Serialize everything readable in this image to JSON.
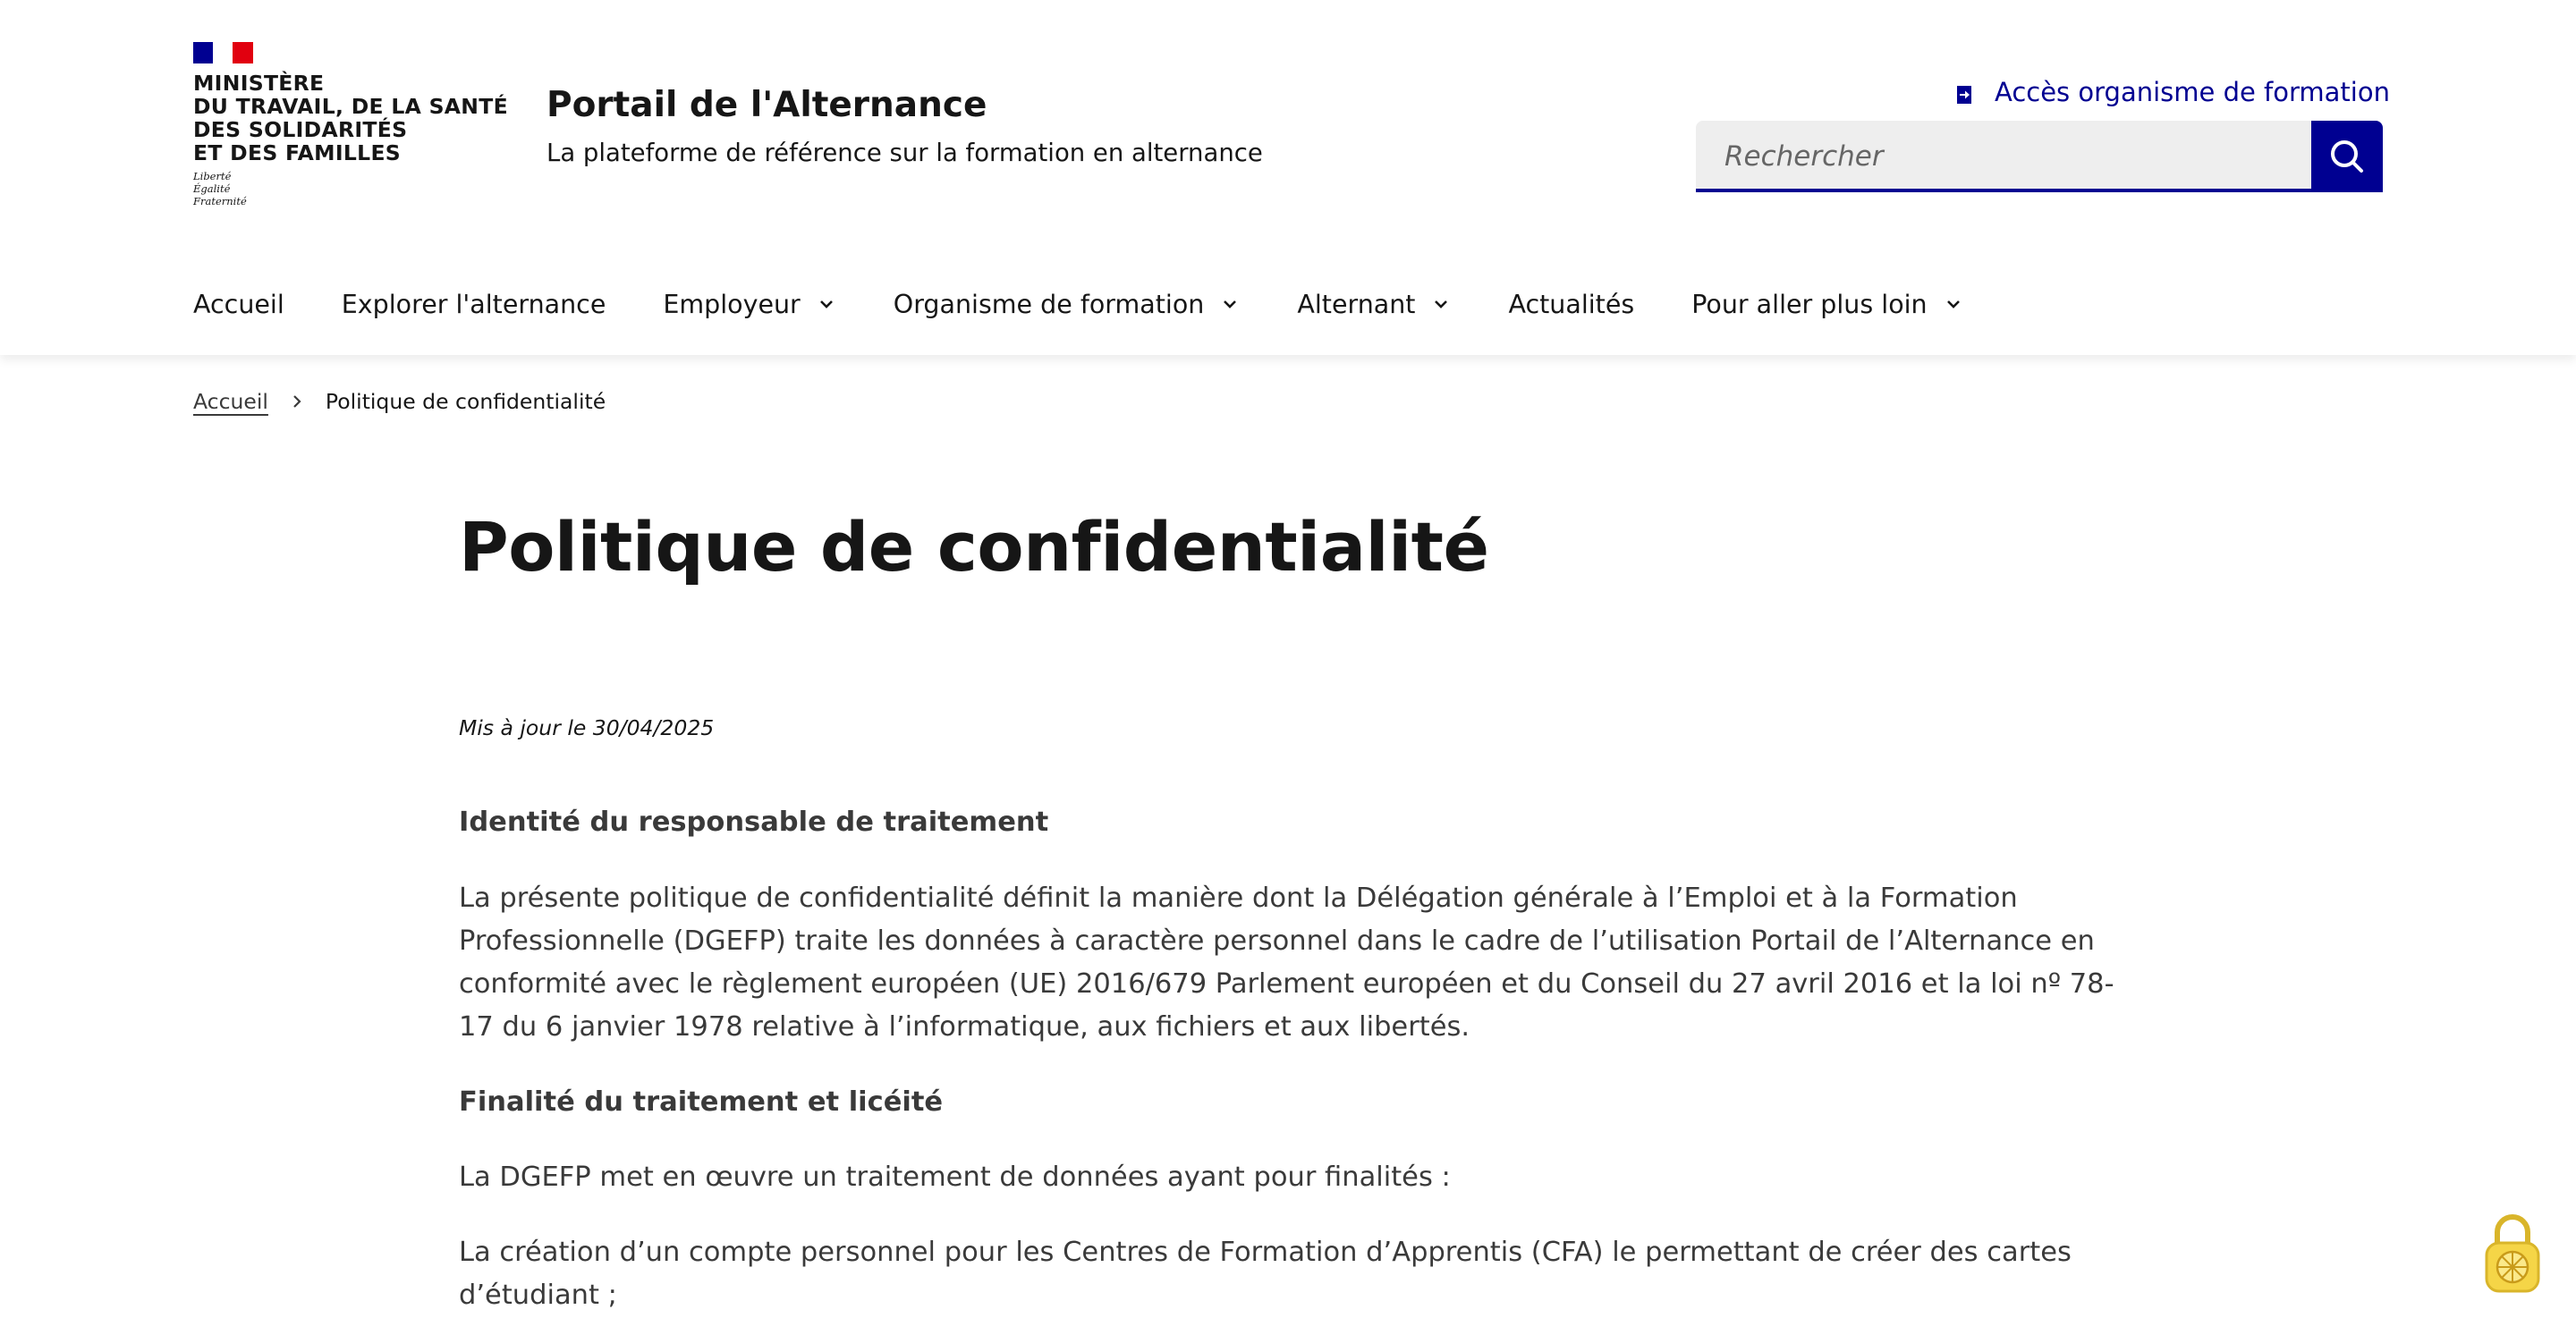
{
  "header": {
    "ministry_lines": [
      "MINISTÈRE",
      "DU TRAVAIL, DE LA SANTÉ",
      "DES SOLIDARITÉS",
      "ET DES FAMILLES"
    ],
    "motto_lines": [
      "Liberté",
      "Égalité",
      "Fraternité"
    ],
    "site_title": "Portail de l'Alternance",
    "site_tagline": "La plateforme de référence sur la formation en alternance",
    "access_link": "Accès organisme de formation",
    "search": {
      "placeholder": "Rechercher"
    }
  },
  "nav": {
    "items": [
      {
        "label": "Accueil",
        "has_dropdown": false
      },
      {
        "label": "Explorer l'alternance",
        "has_dropdown": false
      },
      {
        "label": "Employeur",
        "has_dropdown": true
      },
      {
        "label": "Organisme de formation",
        "has_dropdown": true
      },
      {
        "label": "Alternant",
        "has_dropdown": true
      },
      {
        "label": "Actualités",
        "has_dropdown": false
      },
      {
        "label": "Pour aller plus loin",
        "has_dropdown": true
      }
    ]
  },
  "breadcrumb": {
    "home": "Accueil",
    "current": "Politique de confidentialité"
  },
  "content": {
    "title": "Politique de confidentialité",
    "updated": "Mis à jour le 30/04/2025",
    "section1_title": "Identité du responsable de traitement",
    "section1_lines": [
      "La présente politique de confidentialité définit la manière dont la Délégation générale à l’Emploi et à la Formation",
      "Professionnelle (DGEFP) traite les données à caractère personnel dans le cadre de l’utilisation Portail de l’Alternance en",
      "conformité avec le règlement européen (UE) 2016/679 Parlement européen et du Conseil du 27 avril 2016 et la loi nº 78-",
      "17 du 6 janvier 1978 relative à l’informatique, aux fichiers et aux libertés."
    ],
    "section2_title": "Finalité du traitement et licéité",
    "section2_para1": "La DGEFP met en œuvre un traitement de données ayant pour finalités :",
    "section2_para2_lines": [
      "La création d’un compte personnel pour les Centres de Formation d’Apprentis (CFA) le permettant de créer des cartes",
      "d’étudiant ;"
    ]
  },
  "colors": {
    "brand_blue": "#000091",
    "brand_red": "#e1000f",
    "text": "#161616",
    "text_body": "#3a3a3a",
    "search_bg": "#eeeeee",
    "lock_accent": "#f5d547"
  },
  "icons": {
    "access": "login-arrow-icon",
    "search": "search-icon",
    "dropdown": "chevron-down-icon",
    "breadcrumb_sep": "chevron-right-icon",
    "widget": "padlock-icon"
  }
}
